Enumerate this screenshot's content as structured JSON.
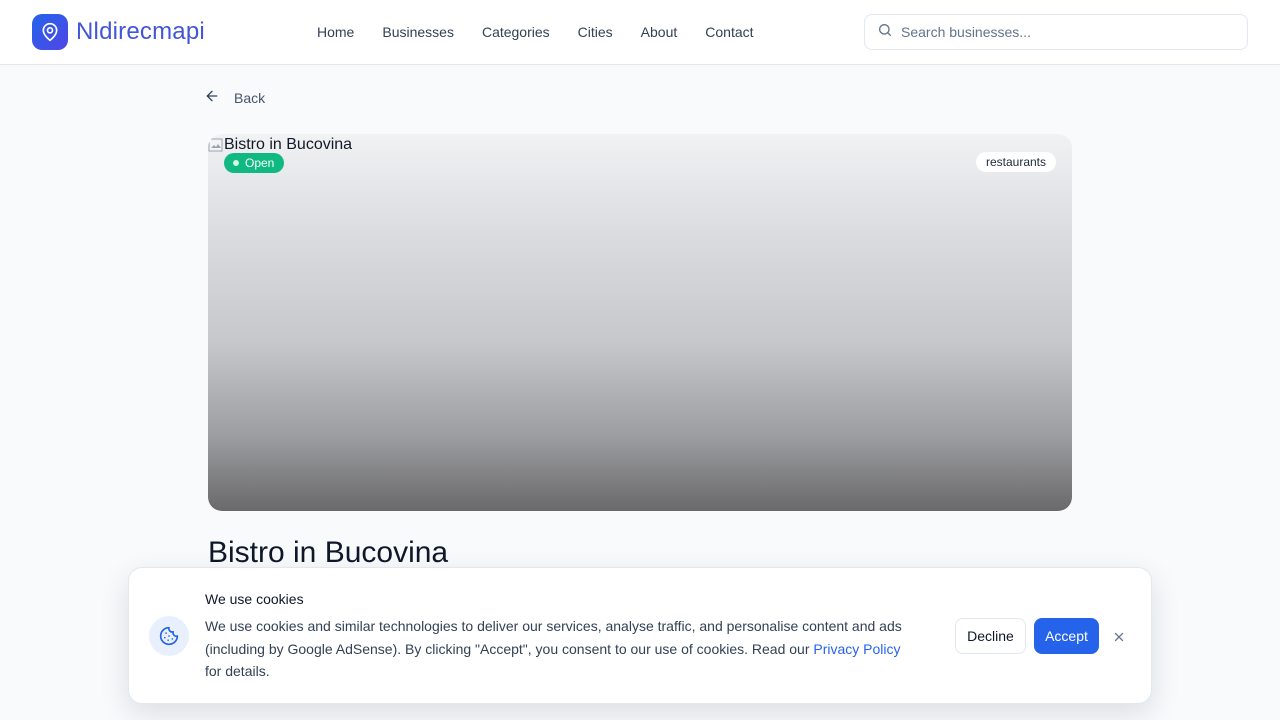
{
  "header": {
    "logo_text": "Nldirecmapi",
    "nav": [
      "Home",
      "Businesses",
      "Categories",
      "Cities",
      "About",
      "Contact"
    ],
    "search_placeholder": "Search businesses..."
  },
  "back_label": "Back",
  "hero": {
    "image_alt": "Bistro in Bucovina",
    "status": "Open",
    "category": "restaurants"
  },
  "business": {
    "name": "Bistro in Bucovina"
  },
  "cookie": {
    "title": "We use cookies",
    "text_before_link": "We use cookies and similar technologies to deliver our services, analyse traffic, and personalise content and ads (including by Google AdSense). By clicking \"Accept\", you consent to our use of cookies. Read our ",
    "link_text": "Privacy Policy",
    "text_after_link": " for details.",
    "decline_label": "Decline",
    "accept_label": "Accept"
  },
  "colors": {
    "brand": "#2563eb",
    "open_badge": "#10b981",
    "logo_text": "#4256d6"
  }
}
